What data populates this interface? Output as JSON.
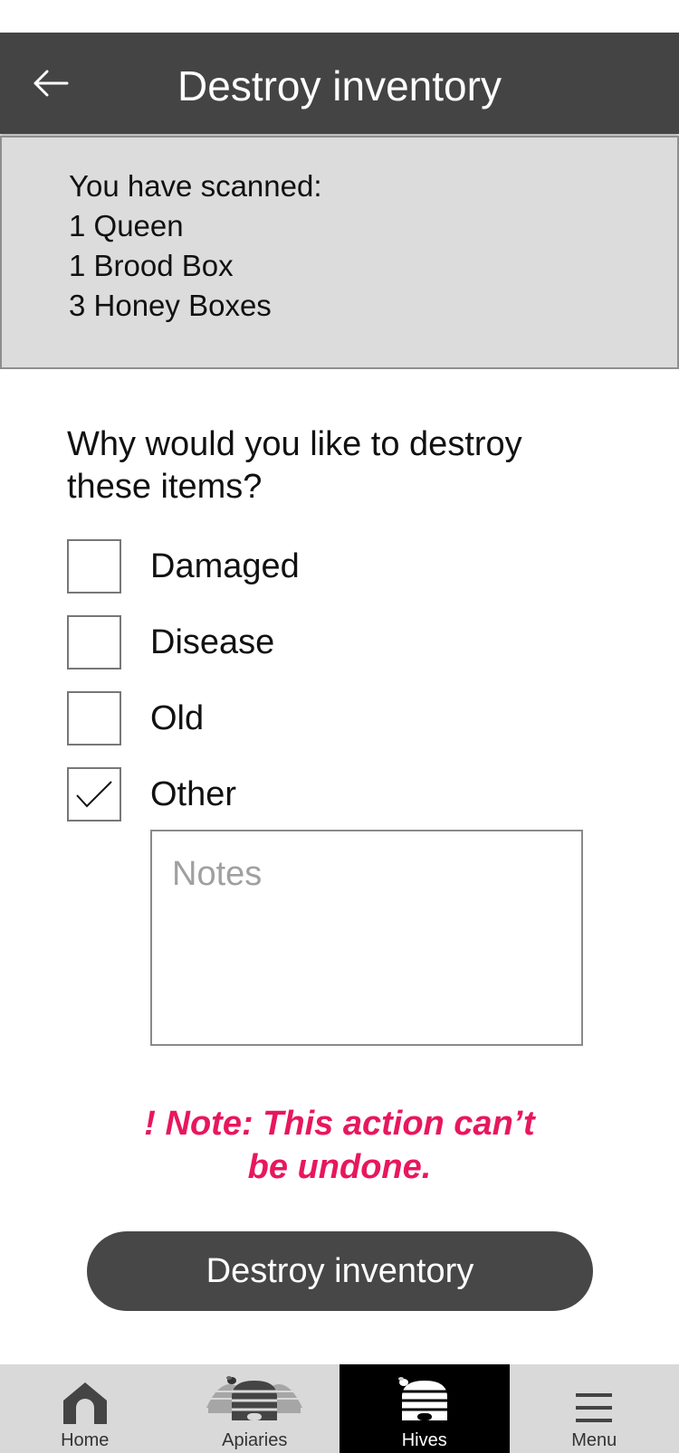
{
  "header": {
    "title": "Destroy inventory",
    "back_icon": "arrow-left-icon"
  },
  "scanned": {
    "intro": "You have scanned:",
    "items": [
      "1 Queen",
      "1 Brood Box",
      "3 Honey Boxes"
    ]
  },
  "question": "Why would you like to destroy these items?",
  "options": [
    {
      "label": "Damaged",
      "checked": false
    },
    {
      "label": "Disease",
      "checked": false
    },
    {
      "label": "Old",
      "checked": false
    },
    {
      "label": "Other",
      "checked": true
    }
  ],
  "notes": {
    "placeholder": "Notes",
    "value": ""
  },
  "warning": {
    "line1": "! Note: This action can’t",
    "line2": "be undone."
  },
  "action_button": "Destroy inventory",
  "tabs": [
    {
      "label": "Home",
      "icon": "home-icon",
      "active": false
    },
    {
      "label": "Apiaries",
      "icon": "apiaries-icon",
      "active": false
    },
    {
      "label": "Hives",
      "icon": "hive-icon",
      "active": true
    },
    {
      "label": "Menu",
      "icon": "menu-icon",
      "active": false
    }
  ],
  "colors": {
    "header": "#444444",
    "warning": "#e8175d",
    "button": "#474747",
    "tabbar": "#d9d9d9",
    "tab_active": "#000000"
  }
}
